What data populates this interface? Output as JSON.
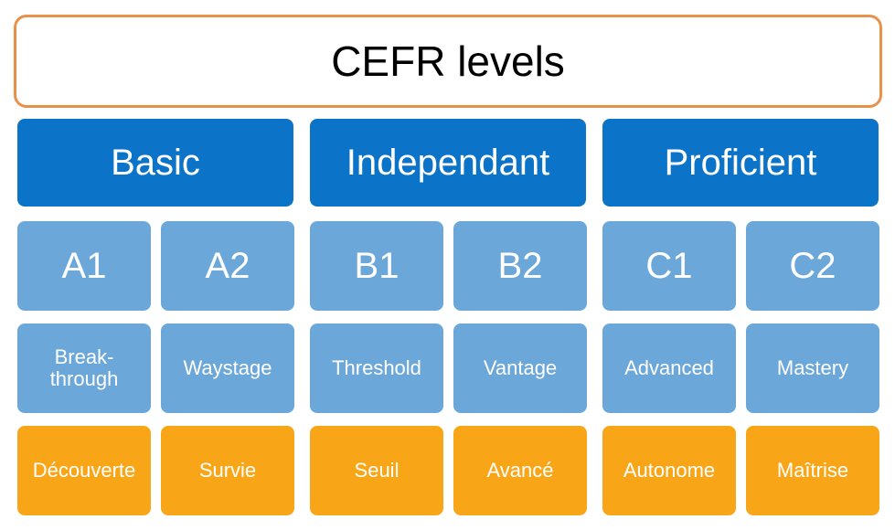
{
  "title": "CEFR levels",
  "colors": {
    "title_border": "#E8914A",
    "category": "#0B74C8",
    "level": "#6CA7D9",
    "french": "#F8A617"
  },
  "categories": [
    "Basic",
    "Independant",
    "Proficient"
  ],
  "levels": [
    "A1",
    "A2",
    "B1",
    "B2",
    "C1",
    "C2"
  ],
  "names": [
    "Break-­through",
    "Waystage",
    "Threshold",
    "Vantage",
    "Advanced",
    "Mastery"
  ],
  "names_display": [
    [
      "Break-",
      "through"
    ],
    [
      "Waystage"
    ],
    [
      "Threshold"
    ],
    [
      "Vantage"
    ],
    [
      "Advanced"
    ],
    [
      "Mastery"
    ]
  ],
  "french": [
    "Découverte",
    "Survie",
    "Seuil",
    "Avancé",
    "Autonome",
    "Maîtrise"
  ]
}
